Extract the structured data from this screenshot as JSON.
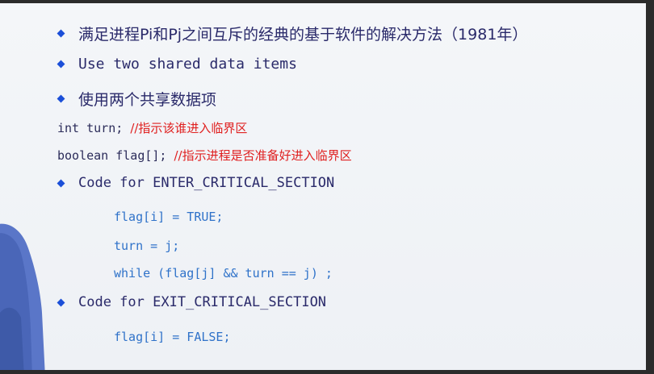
{
  "bullets": {
    "b1": "满足进程Pi和Pj之间互斥的经典的基于软件的解决方法（1981年）",
    "b2": "Use two shared data items",
    "b3": "使用两个共享数据项",
    "b4": "Code for ENTER_CRITICAL_SECTION",
    "b5": "Code for EXIT_CRITICAL_SECTION"
  },
  "declarations": [
    {
      "code": "int turn; ",
      "comment": "//指示该谁进入临界区"
    },
    {
      "code": "boolean flag[]; ",
      "comment": "//指示进程是否准备好进入临界区"
    }
  ],
  "enter_code": [
    "flag[i] = TRUE;",
    "turn = j;",
    "while (flag[j] && turn == j) ;"
  ],
  "exit_code": [
    "flag[i] = FALSE;"
  ],
  "colors": {
    "bullet": "#1b4fd8",
    "comment": "#e02020",
    "code": "#2f72c9"
  },
  "icons": [
    "diamond-bullet-icon"
  ]
}
